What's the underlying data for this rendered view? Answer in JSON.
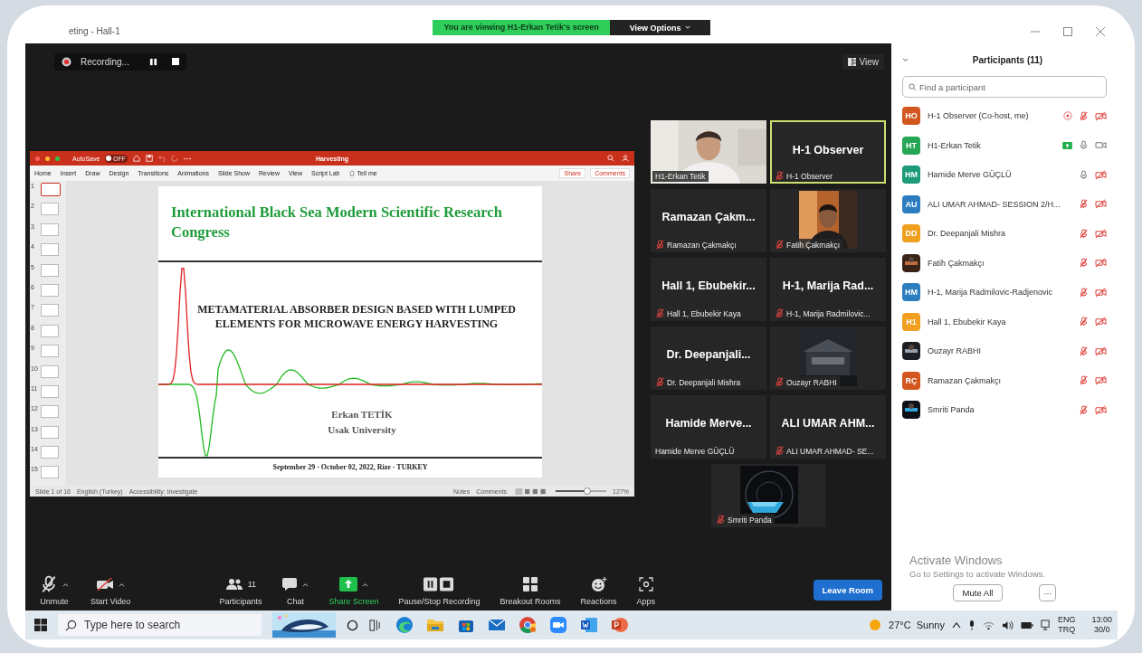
{
  "window": {
    "title": "eting - Hall-1"
  },
  "share_banner": {
    "text": "You are viewing H1-Erkan Tetik's screen",
    "options": "View Options"
  },
  "recording": {
    "label": "Recording..."
  },
  "view_button": "View",
  "presentation": {
    "autosave": "AutoSave",
    "toggle": "OFF",
    "title": "Harvesting",
    "ribbon_tabs": [
      "Home",
      "Insert",
      "Draw",
      "Design",
      "Transitions",
      "Animations",
      "Slide Show",
      "Review",
      "View",
      "Script Lab"
    ],
    "tell_me": "Tell me",
    "share": "Share",
    "comments": "Comments",
    "thumbnails": [
      {
        "number": "1",
        "selected": true
      },
      {
        "number": "2",
        "selected": false
      },
      {
        "number": "3",
        "selected": false
      },
      {
        "number": "4",
        "selected": false
      },
      {
        "number": "5",
        "selected": false
      },
      {
        "number": "6",
        "selected": false
      },
      {
        "number": "7",
        "selected": false
      },
      {
        "number": "8",
        "selected": false
      },
      {
        "number": "9",
        "selected": false
      },
      {
        "number": "10",
        "selected": false
      },
      {
        "number": "11",
        "selected": false
      },
      {
        "number": "12",
        "selected": false
      },
      {
        "number": "13",
        "selected": false
      },
      {
        "number": "14",
        "selected": false
      },
      {
        "number": "15",
        "selected": false
      }
    ],
    "slide": {
      "title": "International Black Sea Modern Scientific Research Congress",
      "heading": "METAMATERIAL ABSORBER DESIGN BASED WITH LUMPED ELEMENTS FOR MICROWAVE ENERGY HARVESTING",
      "author": "Erkan TETİK",
      "affiliation": "Usak University",
      "footer": "September 29 - October 02, 2022, Rize - TURKEY"
    },
    "status": {
      "slide": "Slide 1 of 16",
      "language": "English (Turkey)",
      "accessibility": "Accessibility: Investigate",
      "notes": "Notes",
      "comments": "Comments",
      "zoom": {
        "level": 0.62,
        "reading": "127%"
      }
    }
  },
  "video_tiles": [
    {
      "kind": "video",
      "label": "H1-Erkan Tetik",
      "muted": false,
      "active": false
    },
    {
      "kind": "name",
      "title": "H-1 Observer",
      "label": "H-1 Observer",
      "muted": true,
      "active": true
    },
    {
      "kind": "name",
      "title": "Ramazan  Çakm...",
      "label": "Ramazan Çakmakçı",
      "muted": true,
      "active": false
    },
    {
      "kind": "avatar",
      "label": "Fatih Çakmakçı",
      "muted": true,
      "active": false
    },
    {
      "kind": "name",
      "title": "Hall 1, Ebubekir...",
      "label": "Hall 1, Ebubekir Kaya",
      "muted": true,
      "active": false
    },
    {
      "kind": "name",
      "title": "H-1, Marija Rad...",
      "label": "H-1, Marija Radmilovic...",
      "muted": true,
      "active": false
    },
    {
      "kind": "name",
      "title": "Dr.  Deepanjali...",
      "label": "Dr. Deepanjali Mishra",
      "muted": true,
      "active": false
    },
    {
      "kind": "avatar",
      "label": "Ouzayr RABHI",
      "muted": true,
      "active": false
    },
    {
      "kind": "name",
      "title": "Hamide  Merve...",
      "label": "Hamide Merve GÜÇLÜ",
      "muted": false,
      "active": false
    },
    {
      "kind": "name",
      "title": "ALI UMAR AHM...",
      "label": "ALI UMAR AHMAD- SE...",
      "muted": true,
      "active": false
    },
    {
      "kind": "avatar",
      "label": "Smriti Panda",
      "muted": true,
      "active": false
    }
  ],
  "participants": {
    "title": "Participants (11)",
    "search": {
      "placeholder": "Find a participant"
    },
    "items": [
      {
        "name": "H-1 Observer (Co-host, me)",
        "photo": false,
        "initials": "HO",
        "color": "#d4561f",
        "recording": true,
        "sharing": false,
        "mic_muted": true,
        "video_on": false
      },
      {
        "name": "H1-Erkan Tetik",
        "photo": false,
        "initials": "HT",
        "color": "#26a654",
        "recording": false,
        "sharing": true,
        "mic_muted": false,
        "video_on": true
      },
      {
        "name": "Hamide Merve GÜÇLÜ",
        "photo": false,
        "initials": "HM",
        "color": "#1b9b78",
        "recording": false,
        "sharing": false,
        "mic_muted": false,
        "video_on": false
      },
      {
        "name": "ALI UMAR AHMAD- SESSION 2/H...",
        "photo": false,
        "initials": "AU",
        "color": "#2b7dc0",
        "recording": false,
        "sharing": false,
        "mic_muted": true,
        "video_on": false
      },
      {
        "name": "Dr. Deepanjali Mishra",
        "photo": false,
        "initials": "DD",
        "color": "#f0a01e",
        "recording": false,
        "sharing": false,
        "mic_muted": true,
        "video_on": false
      },
      {
        "name": "Fatih Çakmakçı",
        "photo": true,
        "recording": false,
        "sharing": false,
        "mic_muted": true,
        "video_on": false
      },
      {
        "name": "H-1, Marija Radmilovic-Radjenovic",
        "photo": false,
        "initials": "HM",
        "color": "#2b7dc0",
        "recording": false,
        "sharing": false,
        "mic_muted": true,
        "video_on": false
      },
      {
        "name": "Hall 1, Ebubekir Kaya",
        "photo": false,
        "initials": "H1",
        "color": "#f0a01e",
        "recording": false,
        "sharing": false,
        "mic_muted": true,
        "video_on": false
      },
      {
        "name": "Ouzayr RABHI",
        "photo": true,
        "recording": false,
        "sharing": false,
        "mic_muted": true,
        "video_on": false
      },
      {
        "name": "Ramazan Çakmakçı",
        "photo": false,
        "initials": "RÇ",
        "color": "#d4561f",
        "recording": false,
        "sharing": false,
        "mic_muted": true,
        "video_on": false
      },
      {
        "name": "Smriti Panda",
        "photo": true,
        "recording": false,
        "sharing": false,
        "mic_muted": true,
        "video_on": false
      }
    ],
    "mute_all": "Mute All",
    "more": "···"
  },
  "activation": {
    "title": "Activate Windows",
    "hint": "Go to Settings to activate Windows."
  },
  "toolbar": {
    "buttons": [
      {
        "kind": "mic-muted",
        "label": "Unmute",
        "caret": true
      },
      {
        "kind": "video-off",
        "label": "Start Video",
        "caret": true
      },
      {
        "kind": "participants",
        "label": "Participants",
        "count": "11",
        "caret": false
      },
      {
        "kind": "chat",
        "label": "Chat",
        "caret": true
      },
      {
        "kind": "share",
        "label": "Share Screen",
        "caret": true
      },
      {
        "kind": "record",
        "label": "Pause/Stop Recording",
        "caret": false
      },
      {
        "kind": "breakout",
        "label": "Breakout Rooms",
        "caret": false
      },
      {
        "kind": "reactions",
        "label": "Reactions",
        "caret": false
      },
      {
        "kind": "apps",
        "label": "Apps",
        "caret": false
      }
    ],
    "leave": "Leave Room"
  },
  "taskbar": {
    "search": {
      "placeholder": "Type here to search"
    },
    "weather": "27°C  Sunny",
    "language": "ENG",
    "layout": "TRQ",
    "time": "13:00",
    "date": "30/0"
  }
}
